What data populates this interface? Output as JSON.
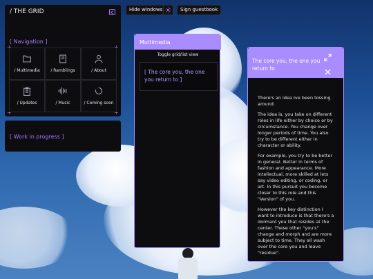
{
  "toolbar": {
    "hide_windows": "Hide windows",
    "settings_icon": "gear-icon",
    "sign_guestbook": "Sign guestbook"
  },
  "grid_window": {
    "title": "/ THE GRID",
    "collapse_icon": "chevron-left-icon",
    "nav_heading": "[ Navigation ]",
    "tiles": [
      {
        "label": "/ Multimedia",
        "icon": "folder-icon"
      },
      {
        "label": "/ Ramblings",
        "icon": "book-icon"
      },
      {
        "label": "/ About",
        "icon": "user-icon"
      },
      {
        "label": "/ Updates",
        "icon": "clipboard-icon"
      },
      {
        "label": "/ Music",
        "icon": "audio-waveform-icon"
      },
      {
        "label": "/ Coming soon",
        "icon": "loading-icon"
      }
    ]
  },
  "wip_window": {
    "heading": "[ Work in progress ]"
  },
  "multimedia_window": {
    "title": "Multimedia",
    "toggle_label": "Toggle grid/list view",
    "card_text": "[ The core you, the one you return to ]"
  },
  "core_window": {
    "title": "The core you, the one you return to",
    "paragraphs": [
      "There's an idea Ive been tossing around.",
      "The idea is, you take on different roles in life either by choice or by circumstance. You change over longer periods of time. You also try to be different either in character or ability.",
      "For example, you try to be better in general. Better in terms of fashion and appearance. More intellectual, more skilled at lets say video editing, or coding, or art. In this pursuit you become closer to this role and this \"Version\" of you.",
      "However the key distinction I want to introduce is that there's a dormant you that resides at the center. These other \"you's\" change and morph and are more subject to time. They all wash over the core you and leave \"residue\"."
    ]
  },
  "colors": {
    "accent": "#a98dff",
    "accent_text": "#a878ff",
    "panel_bg": "#0d0d10",
    "sky": "#1d4f96"
  }
}
